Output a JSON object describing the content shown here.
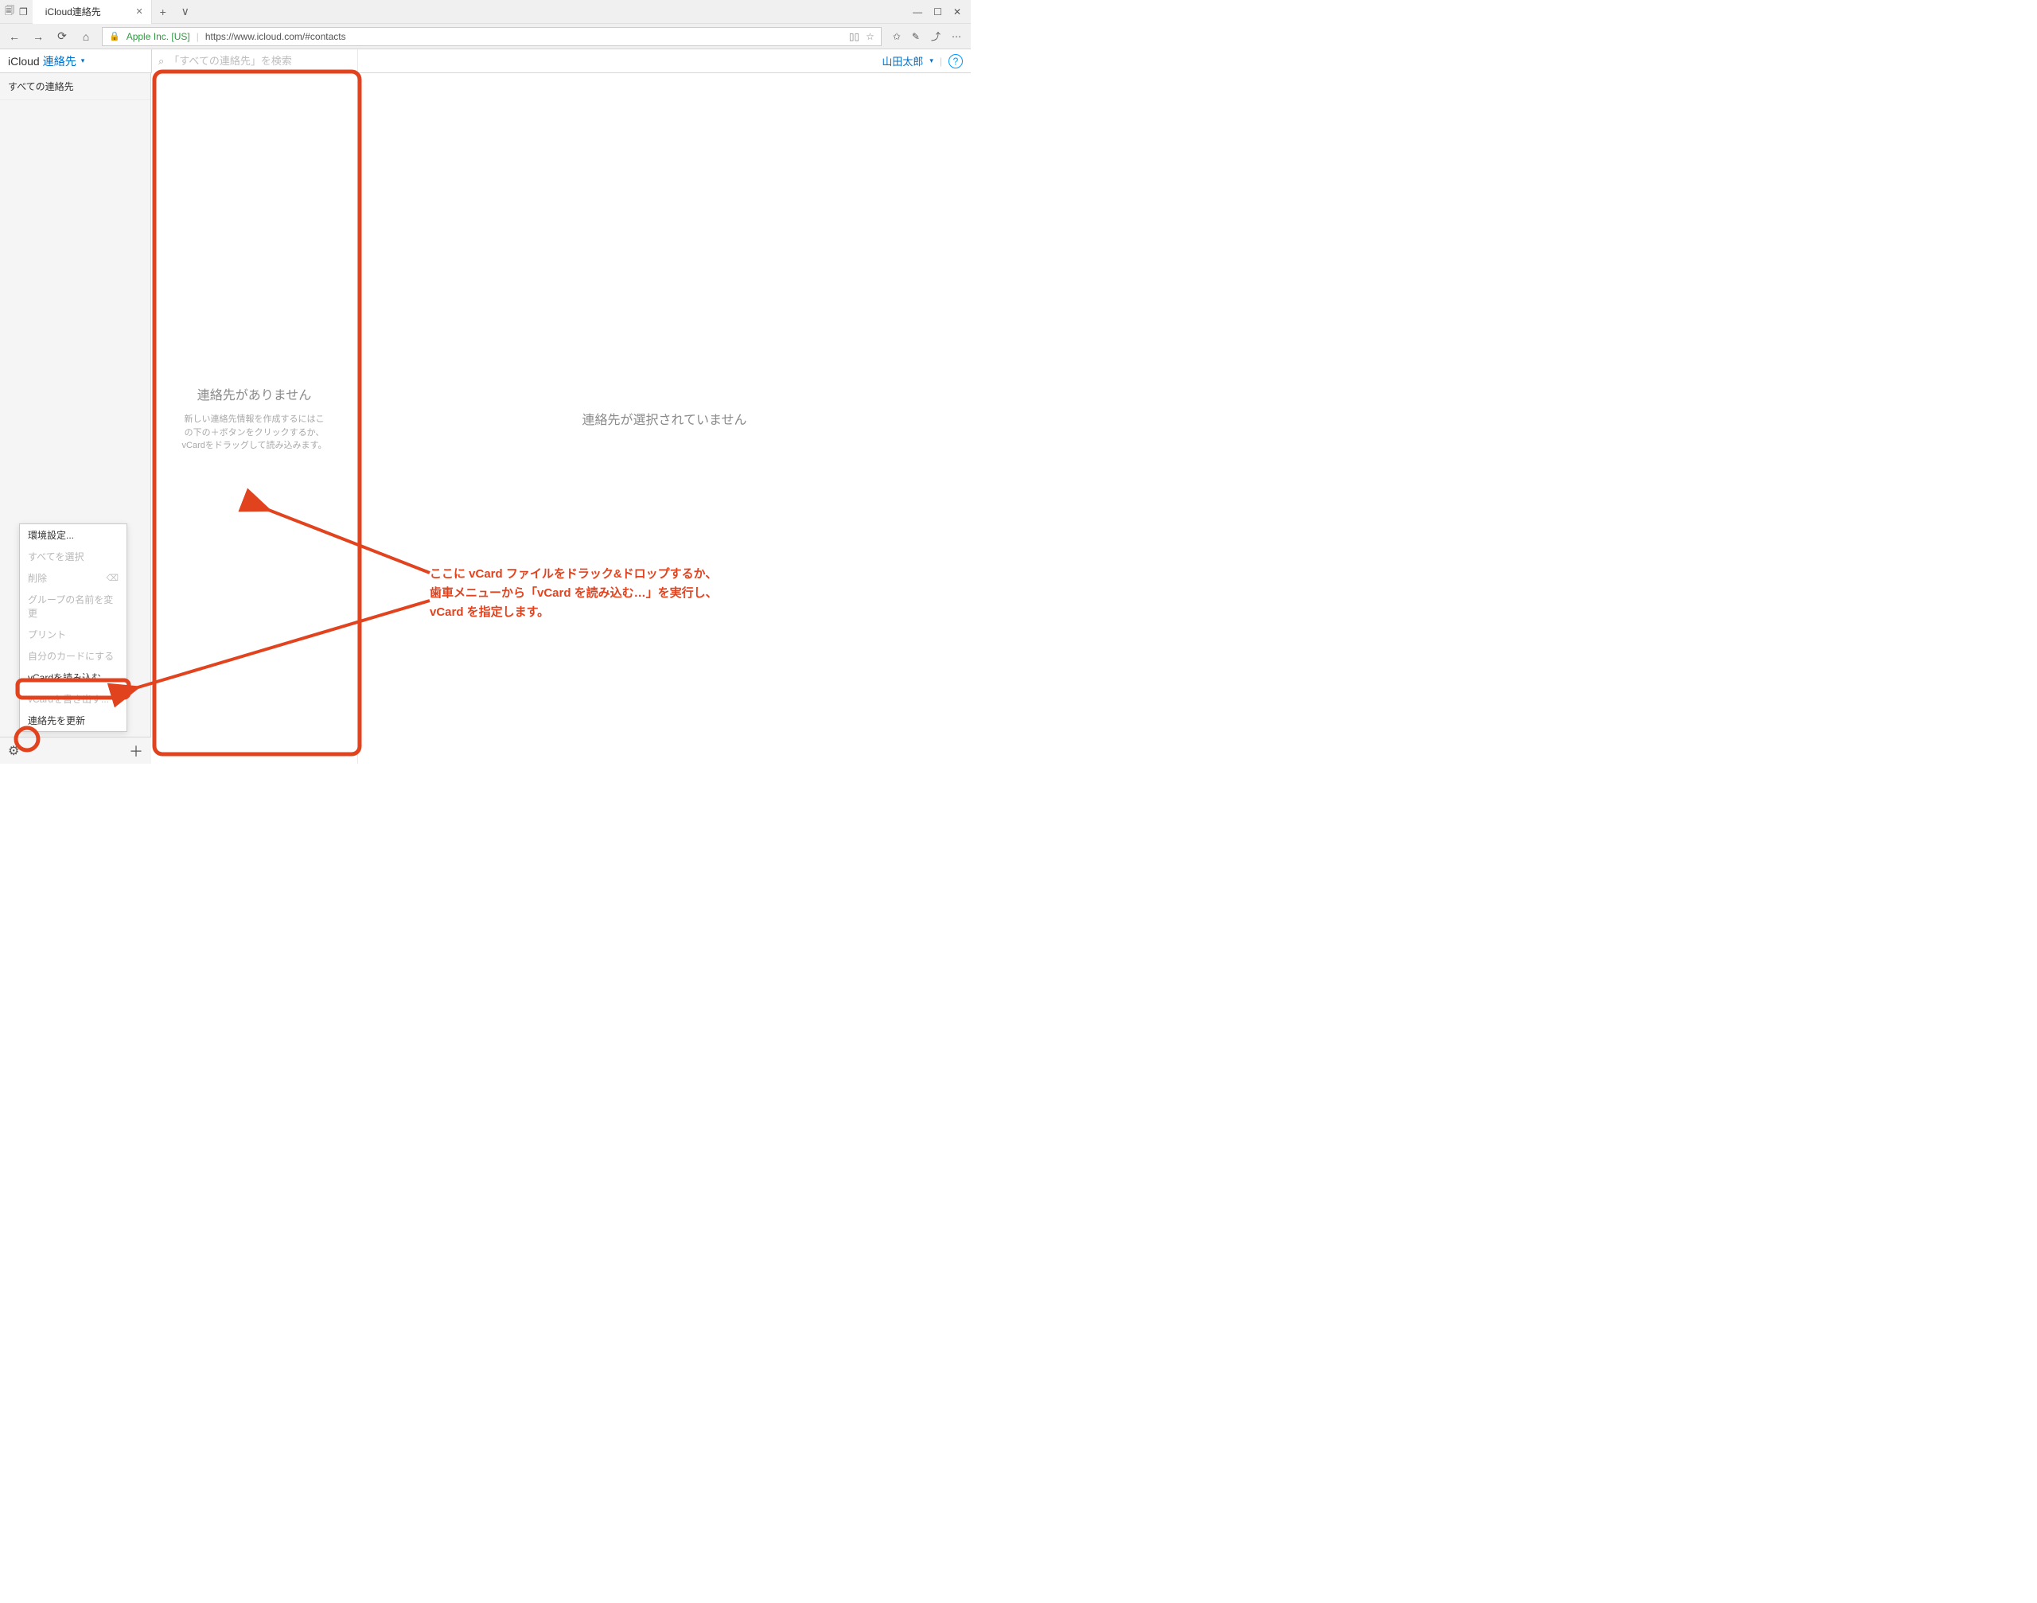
{
  "browser": {
    "tab_title": "iCloud連絡先",
    "new_tab_glyph": "+",
    "tab_dropdown_glyph": "∨",
    "win": {
      "min": "—",
      "max": "☐",
      "close": "✕"
    },
    "nav": {
      "back": "←",
      "forward": "→",
      "refresh": "⟳",
      "home": "⌂"
    },
    "cert_label": "Apple Inc. [US]",
    "url": "https://www.icloud.com/#contacts",
    "right_icons": {
      "star": "☆",
      "starlist": "✩",
      "pen": "✎",
      "fav": "♡",
      "share": "⤴",
      "more": "⋯",
      "reader": "▯▯"
    }
  },
  "header": {
    "icloud": "iCloud",
    "module": "連絡先",
    "search_placeholder": "「すべての連絡先」を検索",
    "user_name": "山田太郎"
  },
  "sidebar": {
    "group_all": "すべての連絡先"
  },
  "list": {
    "empty_title": "連絡先がありません",
    "empty_sub_l1": "新しい連絡先情報を作成するにはこ",
    "empty_sub_l2": "の下の＋ボタンをクリックするか、",
    "empty_sub_l3": "vCardをドラッグして読み込みます。"
  },
  "detail": {
    "empty": "連絡先が選択されていません"
  },
  "menu": {
    "items": [
      {
        "label": "環境設定...",
        "disabled": false,
        "shortcut": ""
      },
      {
        "label": "すべてを選択",
        "disabled": true,
        "shortcut": ""
      },
      {
        "label": "削除",
        "disabled": true,
        "shortcut": "⌫"
      },
      {
        "label": "グループの名前を変更",
        "disabled": true,
        "shortcut": ""
      },
      {
        "label": "プリント",
        "disabled": true,
        "shortcut": ""
      },
      {
        "label": "自分のカードにする",
        "disabled": true,
        "shortcut": ""
      },
      {
        "label": "vCardを読み込む...",
        "disabled": false,
        "shortcut": ""
      },
      {
        "label": "vCardを書き出す...",
        "disabled": true,
        "shortcut": ""
      },
      {
        "label": "連絡先を更新",
        "disabled": false,
        "shortcut": ""
      }
    ]
  },
  "annotation": {
    "line1": "ここに vCard ファイルをドラック&ドロップするか、",
    "line2": "歯車メニューから「vCard を読み込む…」を実行し、",
    "line3": "vCard を指定します。"
  }
}
